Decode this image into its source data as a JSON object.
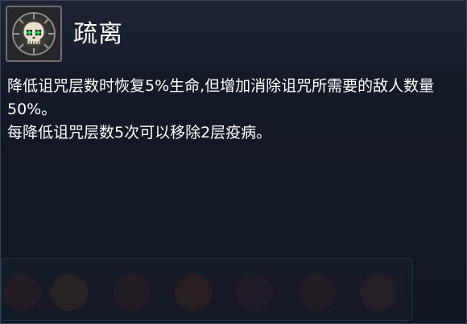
{
  "skill": {
    "icon": "skull-icon",
    "title": "疏离",
    "description": [
      "降低诅咒层数时恢复5%生命,但增加消除诅咒所需要的敌人数量50%。",
      "每降低诅咒层数5次可以移除2层疫病。"
    ]
  },
  "colors": {
    "panel_background": "#141826",
    "panel_border": "#3a4258",
    "text": "#ffffff",
    "skull_eyes": "#2fe65a"
  },
  "background_slots": [
    "faded-item-icon",
    "faded-item-icon",
    "faded-item-icon",
    "faded-item-icon",
    "faded-item-icon",
    "faded-item-icon"
  ]
}
